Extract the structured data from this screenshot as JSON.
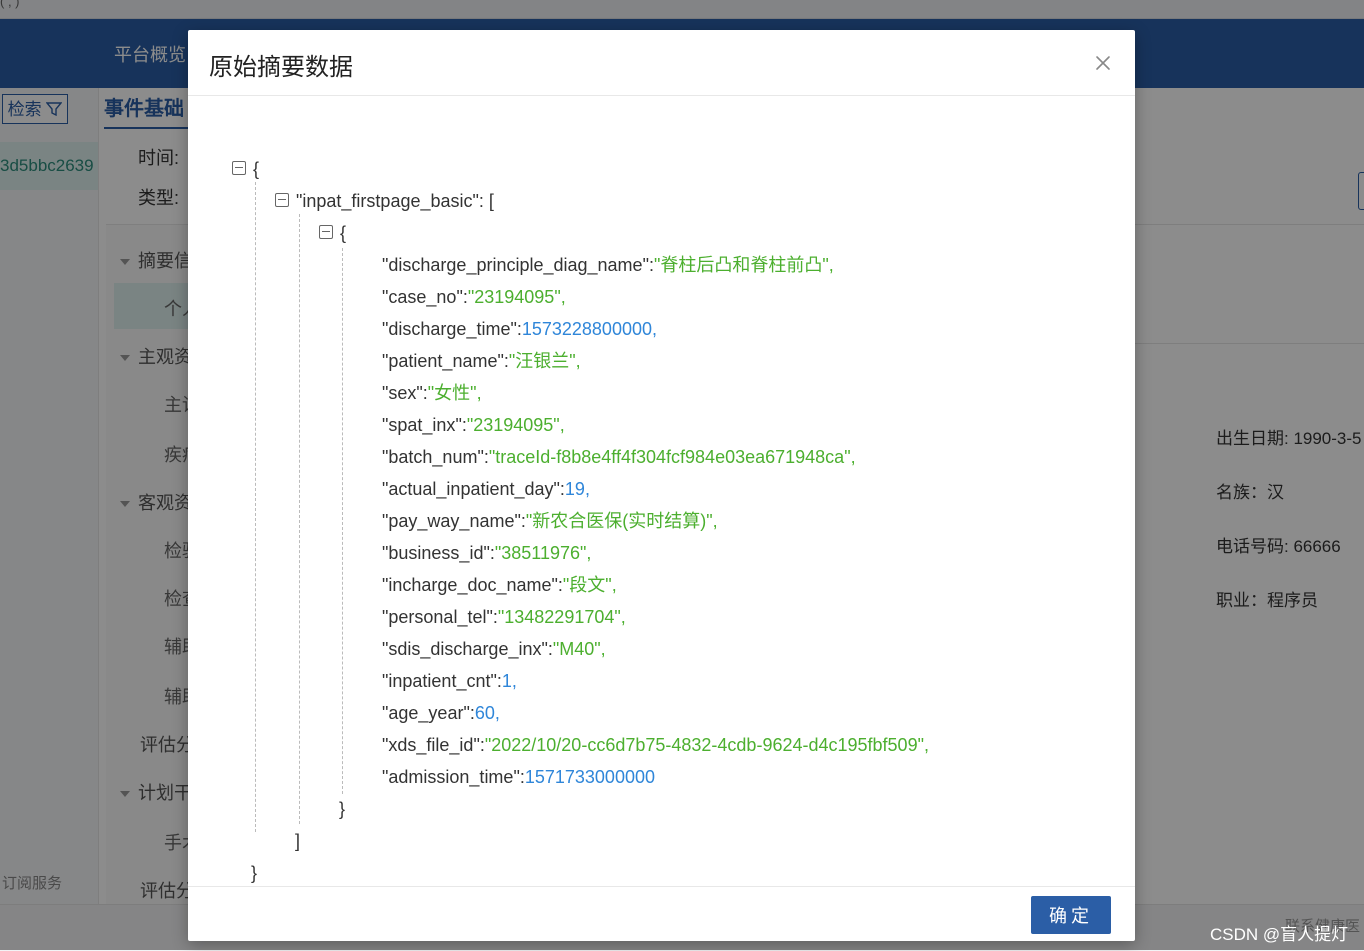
{
  "browser": {
    "address_fragment": "(                        ,         )"
  },
  "topnav": {
    "item": "平台概览"
  },
  "left": {
    "filter_label": "检索",
    "record_id": "3d5bbc2639",
    "subscribe": "订阅服务"
  },
  "page": {
    "tab": "事件基础",
    "time_label": "时间:",
    "type_label": "类型:",
    "tree": {
      "summary": "摘要信",
      "personal": "个人",
      "subjective": "主观资",
      "chief": "主诉",
      "disease": "疾病",
      "objective": "客观资",
      "exam1": "检验",
      "exam2": "检查",
      "aux1": "辅助",
      "aux2": "辅助",
      "eval1": "评估分",
      "plan": "计划干",
      "surgery": "手术",
      "eval2": "评估分"
    },
    "info": {
      "birth": "出生日期: 1990-3-5",
      "ethnicity": "名族：汉",
      "phone": "电话号码: 66666",
      "job": "职业：程序员"
    },
    "footer": "联系健康医"
  },
  "watermark": "CSDN @盲人提灯",
  "modal": {
    "title": "原始摘要数据",
    "ok_label": "确定",
    "root_key": "inpat_firstpage_basic",
    "record": [
      {
        "key": "discharge_principle_diag_name",
        "value": "\"脊柱后凸和脊柱前凸\"",
        "type": "string"
      },
      {
        "key": "case_no",
        "value": "\"23194095\"",
        "type": "string"
      },
      {
        "key": "discharge_time",
        "value": "1573228800000",
        "type": "number"
      },
      {
        "key": "patient_name",
        "value": "\"汪银兰\"",
        "type": "string"
      },
      {
        "key": "sex",
        "value": "\"女性\"",
        "type": "string"
      },
      {
        "key": "spat_inx",
        "value": "\"23194095\"",
        "type": "string"
      },
      {
        "key": "batch_num",
        "value": "\"traceId-f8b8e4ff4f304fcf984e03ea671948ca\"",
        "type": "string"
      },
      {
        "key": "actual_inpatient_day",
        "value": "19",
        "type": "number"
      },
      {
        "key": "pay_way_name",
        "value": "\"新农合医保(实时结算)\"",
        "type": "string"
      },
      {
        "key": "business_id",
        "value": "\"38511976\"",
        "type": "string"
      },
      {
        "key": "incharge_doc_name",
        "value": "\"段文\"",
        "type": "string"
      },
      {
        "key": "personal_tel",
        "value": "\"13482291704\"",
        "type": "string"
      },
      {
        "key": "sdis_discharge_inx",
        "value": "\"M40\"",
        "type": "string"
      },
      {
        "key": "inpatient_cnt",
        "value": "1",
        "type": "number"
      },
      {
        "key": "age_year",
        "value": "60",
        "type": "number"
      },
      {
        "key": "xds_file_id",
        "value": "\"2022/10/20-cc6d7b75-4832-4cdb-9624-d4c195fbf509\"",
        "type": "string"
      },
      {
        "key": "admission_time",
        "value": "1571733000000",
        "type": "number"
      }
    ]
  }
}
